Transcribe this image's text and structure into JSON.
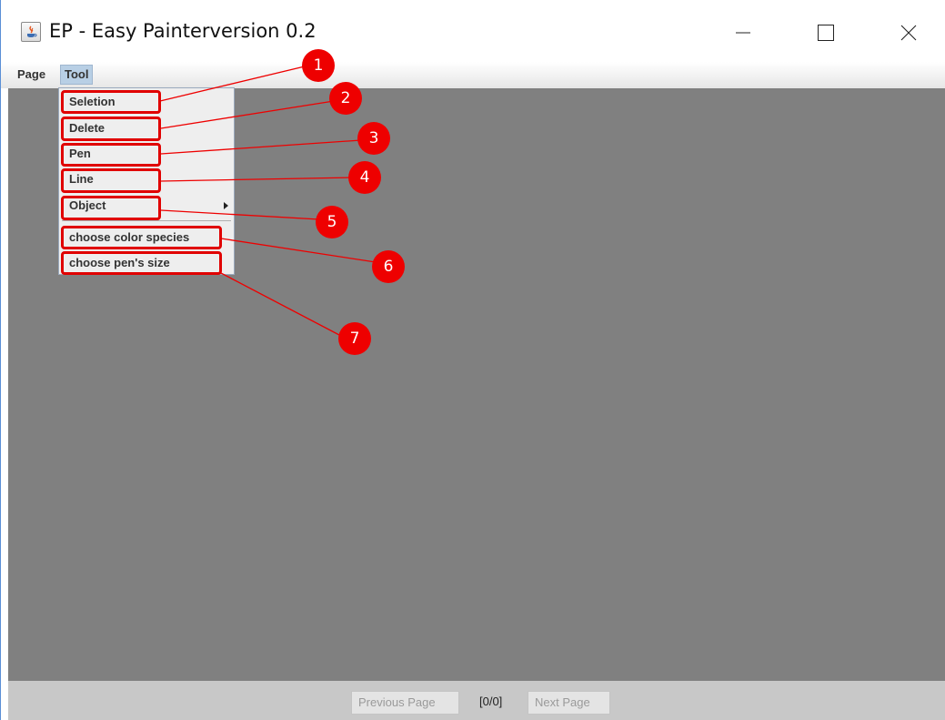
{
  "window": {
    "title": "EP - Easy Painterversion 0.2",
    "controls": {
      "minimize": "minimize-icon",
      "maximize": "maximize-icon",
      "close": "close-icon"
    }
  },
  "menubar": {
    "items": [
      "Page",
      "Tool"
    ],
    "active": "Tool"
  },
  "tool_menu": {
    "items": [
      "Seletion",
      "Delete",
      "Pen",
      "Line",
      "Object",
      "choose color species",
      "choose pen's size"
    ]
  },
  "footer": {
    "previous_label": "Previous Page",
    "counter": "[0/0]",
    "next_label": "Next Page"
  },
  "annotations": {
    "markers": [
      "1",
      "2",
      "3",
      "4",
      "5",
      "6",
      "7"
    ],
    "color": "#ee0000"
  },
  "colors": {
    "canvas": "#808080",
    "footer": "#c8c8c8",
    "menu_active": "#b8cfe5"
  }
}
